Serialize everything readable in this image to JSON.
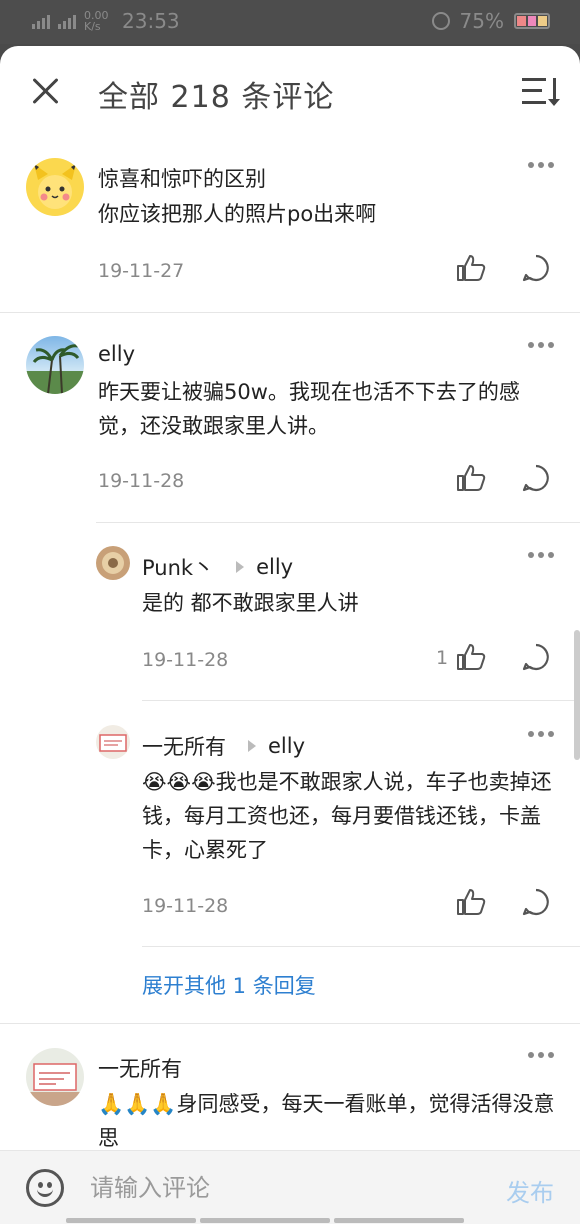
{
  "status_bar": {
    "time": "23:53",
    "net_speed": "0.00 K/s",
    "battery": "75%"
  },
  "header": {
    "title": "全部 218 条评论"
  },
  "comments": [
    {
      "author": "惊喜和惊吓的区别",
      "text": "你应该把那人的照片po出来啊",
      "date": "19-11-27"
    },
    {
      "author": "elly",
      "text": "昨天要让被骗50w。我现在也活不下去了的感觉，还没敢跟家里人讲。",
      "date": "19-11-28",
      "replies": [
        {
          "author": "Punk丶",
          "reply_to": "elly",
          "text": "是的 都不敢跟家里人讲",
          "date": "19-11-28",
          "likes": "1"
        },
        {
          "author": "一无所有",
          "reply_to": "elly",
          "text": "😭😭😭我也是不敢跟家人说，车子也卖掉还钱，每月工资也还，每月要借钱还钱，卡盖卡，心累死了",
          "date": "19-11-28"
        }
      ],
      "expand_more": "展开其他 1 条回复"
    },
    {
      "author": "一无所有",
      "text": "🙏🙏🙏身同感受，每天一看账单，觉得活得没意思"
    }
  ],
  "input": {
    "placeholder": "请输入评论",
    "send_label": "发布"
  },
  "colors": {
    "link": "#2d7fd0",
    "send_disabled": "#a9cdef"
  }
}
